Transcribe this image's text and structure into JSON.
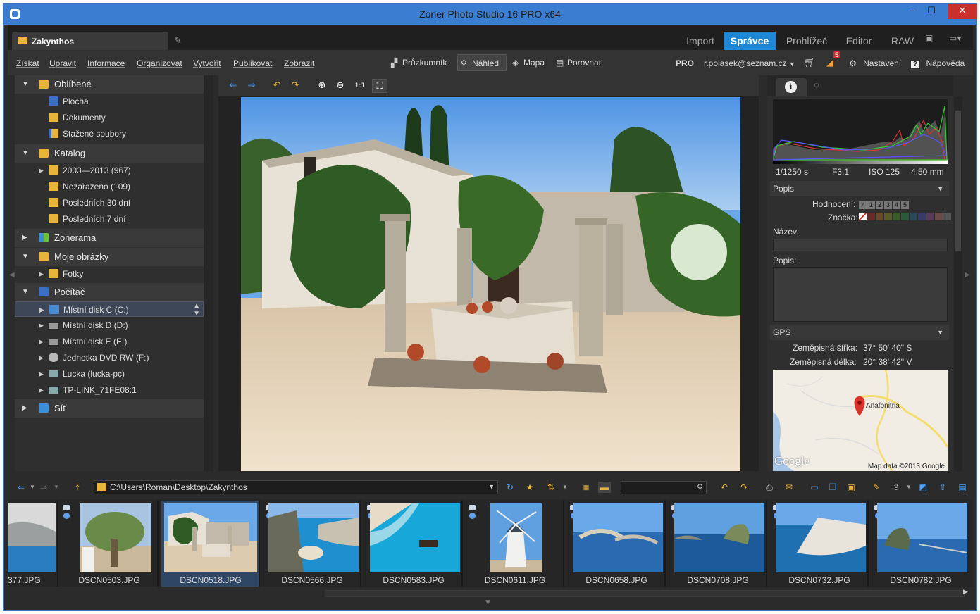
{
  "window": {
    "title": "Zoner Photo Studio 16 PRO x64"
  },
  "doc_tab": {
    "label": "Zakynthos"
  },
  "mode_tabs": [
    {
      "label": "Import",
      "active": false
    },
    {
      "label": "Správce",
      "active": true
    },
    {
      "label": "Prohlížeč",
      "active": false
    },
    {
      "label": "Editor",
      "active": false
    },
    {
      "label": "RAW",
      "active": false
    }
  ],
  "menu": [
    "Získat",
    "Upravit",
    "Informace",
    "Organizovat",
    "Vytvořit",
    "Publikovat",
    "Zobrazit"
  ],
  "view_buttons": [
    {
      "label": "Průzkumník",
      "icon": "explorer-icon",
      "active": false
    },
    {
      "label": "Náhled",
      "icon": "magnifier-icon",
      "active": true
    },
    {
      "label": "Mapa",
      "icon": "map-icon",
      "active": false
    },
    {
      "label": "Porovnat",
      "icon": "compare-icon",
      "active": false
    }
  ],
  "account": {
    "pro": "PRO",
    "email": "r.polasek@seznam.cz",
    "rss_count": "5",
    "settings": "Nastavení",
    "help": "Nápověda"
  },
  "tree": {
    "favorites": {
      "label": "Oblíbené",
      "items": [
        "Plocha",
        "Dokumenty",
        "Stažené soubory"
      ]
    },
    "catalog": {
      "label": "Katalog",
      "items": [
        "2003—2013 (967)",
        "Nezařazeno (109)",
        "Posledních 30 dní",
        "Posledních 7 dní"
      ]
    },
    "zonerama": {
      "label": "Zonerama"
    },
    "pictures": {
      "label": "Moje obrázky",
      "items": [
        "Fotky"
      ]
    },
    "computer": {
      "label": "Počítač",
      "items": [
        "Místní disk C (C:)",
        "Místní disk D (D:)",
        "Místní disk E (E:)",
        "Jednotka DVD RW (F:)",
        "Lucka (lucka-pc)",
        "TP-LINK_71FE08:1"
      ]
    },
    "network": {
      "label": "Síť"
    }
  },
  "info_panel": {
    "exif": {
      "shutter": "1/1250 s",
      "aperture": "F3.1",
      "iso": "ISO 125",
      "focal": "4.50 mm"
    },
    "popis_section": "Popis",
    "rating_label": "Hodnocení:",
    "rating_values": [
      "1",
      "2",
      "3",
      "4",
      "5"
    ],
    "tag_label": "Značka:",
    "tag_colors": [
      "#6b2a2a",
      "#6b4a2a",
      "#5a5a2a",
      "#3a5a2a",
      "#2a5a3a",
      "#2a4a5a",
      "#3a3a6a",
      "#5a3a5a",
      "#6a4a4a",
      "#555555"
    ],
    "name_label": "Název:",
    "desc_label": "Popis:",
    "gps_section": "GPS",
    "lat_label": "Zeměpisná šířka:",
    "lat_value": "37° 50' 40\" S",
    "lon_label": "Zeměpisná délka:",
    "lon_value": "20° 38' 42\" V",
    "map_place": "Anafonitria",
    "map_logo": "Google",
    "map_credit": "Map data ©2013 Google"
  },
  "pathbar": {
    "path": "C:\\Users\\Roman\\Desktop\\Zakynthos"
  },
  "thumbnails": [
    {
      "name": "377.JPG",
      "selected": false
    },
    {
      "name": "DSCN0503.JPG",
      "selected": false
    },
    {
      "name": "DSCN0518.JPG",
      "selected": true
    },
    {
      "name": "DSCN0566.JPG",
      "selected": false
    },
    {
      "name": "DSCN0583.JPG",
      "selected": false
    },
    {
      "name": "DSCN0611.JPG",
      "selected": false
    },
    {
      "name": "DSCN0658.JPG",
      "selected": false
    },
    {
      "name": "DSCN0708.JPG",
      "selected": false
    },
    {
      "name": "DSCN0732.JPG",
      "selected": false
    },
    {
      "name": "DSCN0782.JPG",
      "selected": false
    }
  ],
  "colors": {
    "accent": "#1e88d6",
    "titlebar": "#3b7ed1",
    "close": "#c9302c"
  }
}
